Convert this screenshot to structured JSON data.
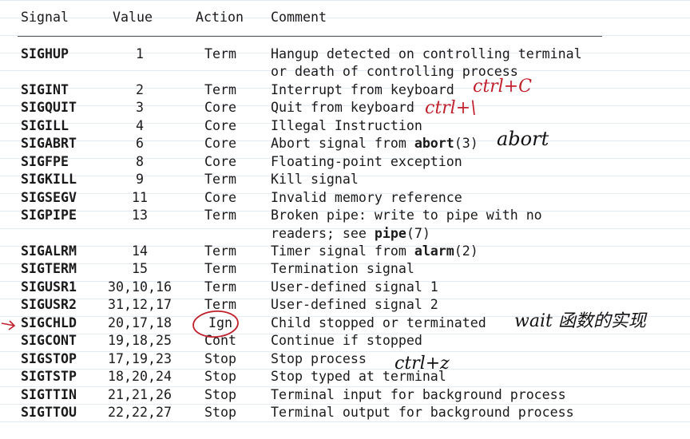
{
  "headers": {
    "signal": "Signal",
    "value": "Value",
    "action": "Action",
    "comment": "Comment"
  },
  "rows": [
    {
      "signal": "SIGHUP",
      "value": "1",
      "action": "Term",
      "comment": "Hangup detected on controlling terminal",
      "comment_cont": "or death of controlling process"
    },
    {
      "signal": "SIGINT",
      "value": "2",
      "action": "Term",
      "comment": "Interrupt from keyboard"
    },
    {
      "signal": "SIGQUIT",
      "value": "3",
      "action": "Core",
      "comment": "Quit from keyboard"
    },
    {
      "signal": "SIGILL",
      "value": "4",
      "action": "Core",
      "comment": "Illegal Instruction"
    },
    {
      "signal": "SIGABRT",
      "value": "6",
      "action": "Core",
      "comment_pre": "Abort signal from ",
      "comment_bold": "abort",
      "comment_post": "(3)"
    },
    {
      "signal": "SIGFPE",
      "value": "8",
      "action": "Core",
      "comment": "Floating-point exception"
    },
    {
      "signal": "SIGKILL",
      "value": "9",
      "action": "Term",
      "comment": "Kill signal"
    },
    {
      "signal": "SIGSEGV",
      "value": "11",
      "action": "Core",
      "comment": "Invalid memory reference"
    },
    {
      "signal": "SIGPIPE",
      "value": "13",
      "action": "Term",
      "comment": "Broken pipe: write to pipe with no",
      "comment_cont_pre": "readers; see ",
      "comment_cont_bold": "pipe",
      "comment_cont_post": "(7)"
    },
    {
      "signal": "SIGALRM",
      "value": "14",
      "action": "Term",
      "comment_pre": "Timer signal from ",
      "comment_bold": "alarm",
      "comment_post": "(2)"
    },
    {
      "signal": "SIGTERM",
      "value": "15",
      "action": "Term",
      "comment": "Termination signal"
    },
    {
      "signal": "SIGUSR1",
      "value": "30,10,16",
      "action": "Term",
      "comment": "User-defined signal 1"
    },
    {
      "signal": "SIGUSR2",
      "value": "31,12,17",
      "action": "Term",
      "comment": "User-defined signal 2"
    },
    {
      "signal": "SIGCHLD",
      "value": "20,17,18",
      "action": "Ign",
      "comment": "Child stopped or terminated"
    },
    {
      "signal": "SIGCONT",
      "value": "19,18,25",
      "action": "Cont",
      "comment": "Continue if stopped"
    },
    {
      "signal": "SIGSTOP",
      "value": "17,19,23",
      "action": "Stop",
      "comment": "Stop process"
    },
    {
      "signal": "SIGTSTP",
      "value": "18,20,24",
      "action": "Stop",
      "comment": "Stop typed at terminal"
    },
    {
      "signal": "SIGTTIN",
      "value": "21,21,26",
      "action": "Stop",
      "comment": "Terminal input for background process"
    },
    {
      "signal": "SIGTTOU",
      "value": "22,22,27",
      "action": "Stop",
      "comment": "Terminal output for background process"
    }
  ],
  "annotations": {
    "ctrl_c": "ctrl+C",
    "ctrl_backslash": "ctrl+\\",
    "abort": "abort",
    "wait": "wait 函数的实现",
    "ctrl_z": "ctrl+z"
  },
  "colors": {
    "ink_red": "#c0202c",
    "ink_black": "#111111",
    "rule_blue": "#e4ebf5"
  }
}
